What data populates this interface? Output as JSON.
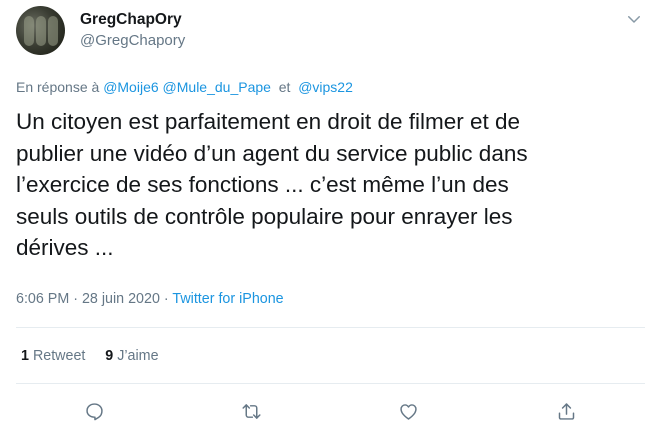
{
  "user": {
    "display_name": "GregChapOry",
    "handle": "@GregChapory"
  },
  "reply": {
    "prefix": "En réponse à",
    "mentions": [
      "@Moije6",
      "@Mule_du_Pape",
      "@vips22"
    ],
    "conjunction": "et"
  },
  "tweet": {
    "lines": [
      "Un citoyen est parfaitement en droit de filmer et de",
      "publier une vidéo d’un agent du service public dans",
      "l’exercice de ses fonctions ... c’est même l’un des",
      "seuls outils de contrôle populaire pour enrayer les",
      "dérives ..."
    ],
    "time": "6:06 PM",
    "separator": "·",
    "date": "28 juin 2020",
    "source": "Twitter for iPhone"
  },
  "stats": {
    "retweet_count": "1",
    "retweet_label": "Retweet",
    "like_count": "9",
    "like_label": "J’aime"
  },
  "icons": {
    "more": "chevron-down-icon",
    "reply": "reply-icon",
    "retweet": "retweet-icon",
    "like": "heart-icon",
    "share": "share-icon"
  },
  "colors": {
    "link": "#1b95e0",
    "secondary": "#657786",
    "text": "#14171a",
    "divider": "#e6ecf0"
  }
}
